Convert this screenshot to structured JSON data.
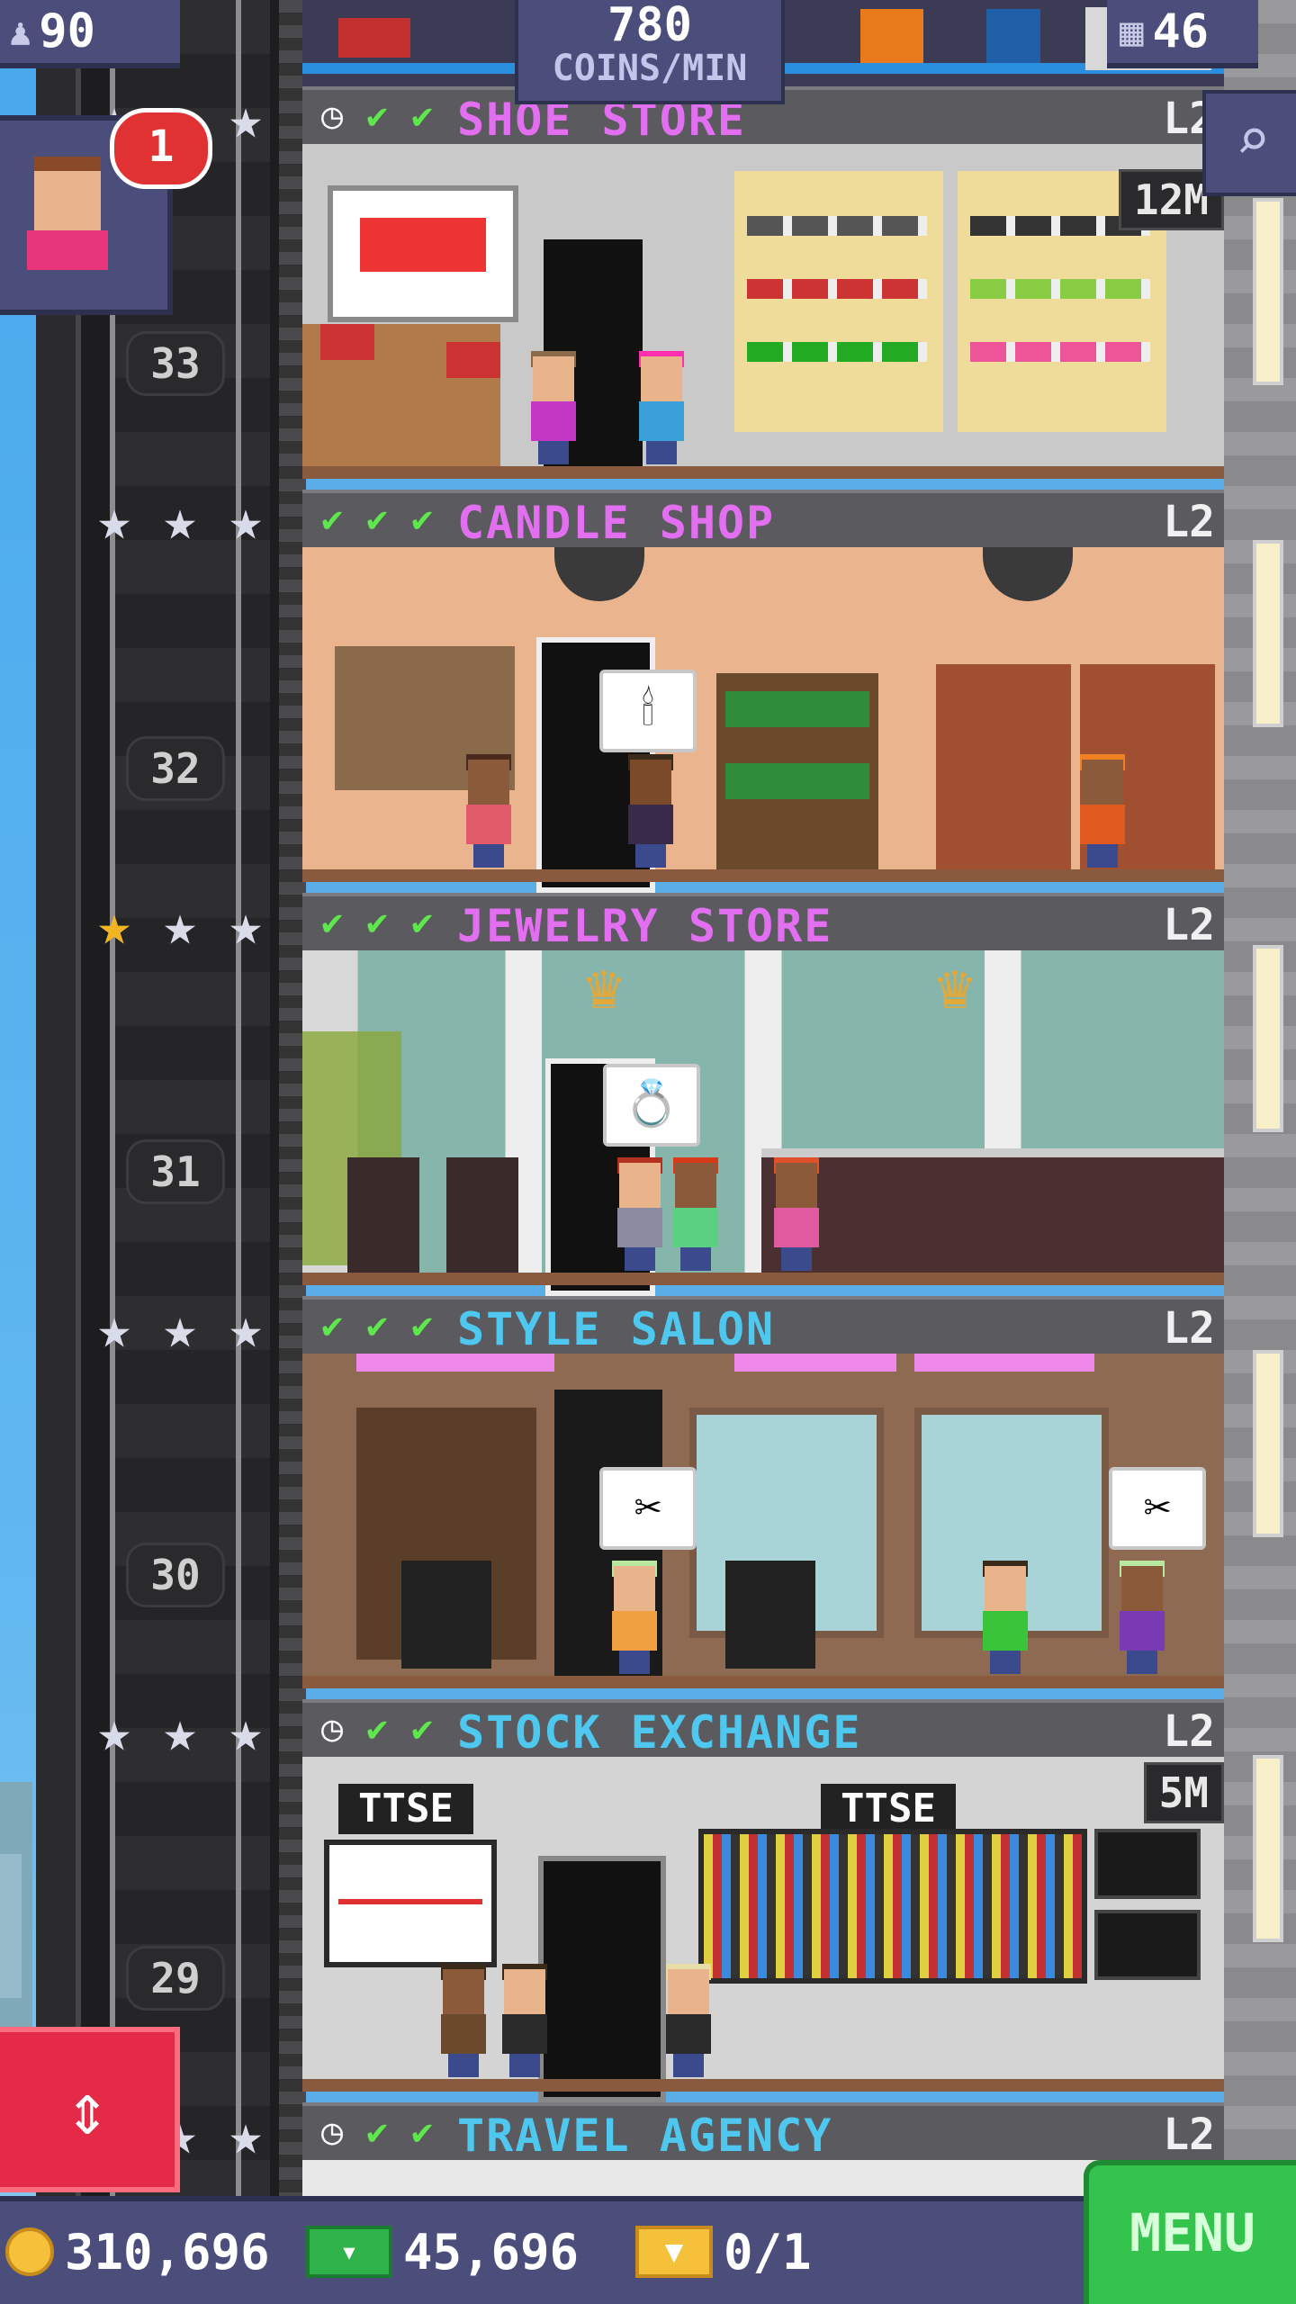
{
  "hud": {
    "population": "90",
    "coins_per_min_value": "780",
    "coins_per_min_label": "COINS/MIN",
    "floors": "46",
    "notification_count": "1"
  },
  "floor_numbers": [
    "33",
    "32",
    "31",
    "30",
    "29"
  ],
  "floors": [
    {
      "name": "SHOE STORE",
      "level": "L2",
      "checks": [
        "clock",
        "check",
        "check"
      ],
      "timer": "12M",
      "name_color": "#e26ef0"
    },
    {
      "name": "CANDLE SHOP",
      "level": "L2",
      "checks": [
        "check",
        "check",
        "check"
      ],
      "timer": "",
      "name_color": "#e26ef0"
    },
    {
      "name": "JEWELRY STORE",
      "level": "L2",
      "checks": [
        "check",
        "check",
        "check"
      ],
      "timer": "",
      "name_color": "#e26ef0"
    },
    {
      "name": "STYLE SALON",
      "level": "L2",
      "checks": [
        "check",
        "check",
        "check"
      ],
      "timer": "",
      "name_color": "#4fc8f0"
    },
    {
      "name": "STOCK EXCHANGE",
      "level": "L2",
      "checks": [
        "clock",
        "check",
        "check"
      ],
      "timer": "5M",
      "name_color": "#4fc8f0"
    },
    {
      "name": "TRAVEL AGENCY",
      "level": "L2",
      "checks": [
        "clock",
        "check",
        "check"
      ],
      "timer": "",
      "name_color": "#4fc8f0"
    }
  ],
  "stock_signs": [
    "TTSE",
    "TTSE"
  ],
  "bottom": {
    "coins": "310,696",
    "bux": "45,696",
    "tickets": "0/1",
    "menu_label": "MENU"
  },
  "colors": {
    "hud_bg": "#4b4e7a",
    "check_green": "#5ee84c",
    "menu_green": "#34c34c",
    "elevator_red": "#e42a46"
  }
}
